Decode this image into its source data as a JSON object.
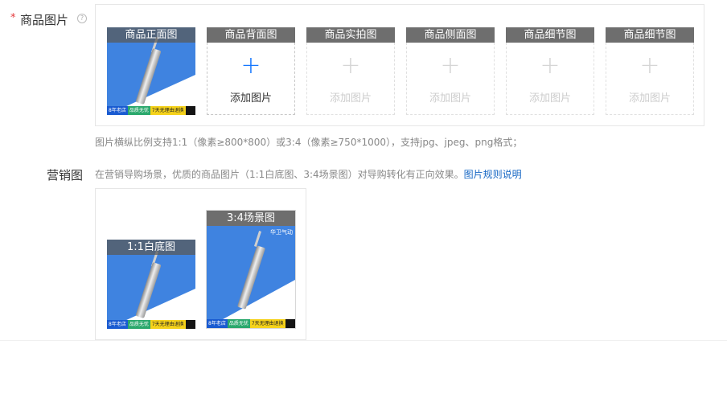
{
  "product_images": {
    "required_mark": "*",
    "label": "商品图片",
    "help_icon": "question-circle-icon",
    "slots": [
      {
        "title": "商品正面图",
        "has_image": true
      },
      {
        "title": "商品背面图",
        "add_label": "添加图片",
        "active": true
      },
      {
        "title": "商品实拍图",
        "add_label": "添加图片"
      },
      {
        "title": "商品侧面图",
        "add_label": "添加图片"
      },
      {
        "title": "商品细节图",
        "add_label": "添加图片"
      },
      {
        "title": "商品细节图",
        "add_label": "添加图片"
      }
    ],
    "hint": "图片横纵比例支持1:1（像素≥800*800）或3:4（像素≥750*1000），支持jpg、jpeg、png格式；"
  },
  "marketing": {
    "label": "营销图",
    "description": "在营销导购场景，优质的商品图片（1:1白底图、3:4场景图）对导购转化有正向效果。",
    "link": "图片规则说明",
    "images": [
      {
        "title": "1:1白底图"
      },
      {
        "title": "3:4场景图"
      }
    ]
  },
  "thumb_strip": {
    "a": "8年老店",
    "b": "品质无忧",
    "c": "7天无理由退换",
    "brand": "华卫气动"
  },
  "colors": {
    "accent": "#1677ff",
    "required": "#e4393c",
    "link": "#1667c4"
  }
}
